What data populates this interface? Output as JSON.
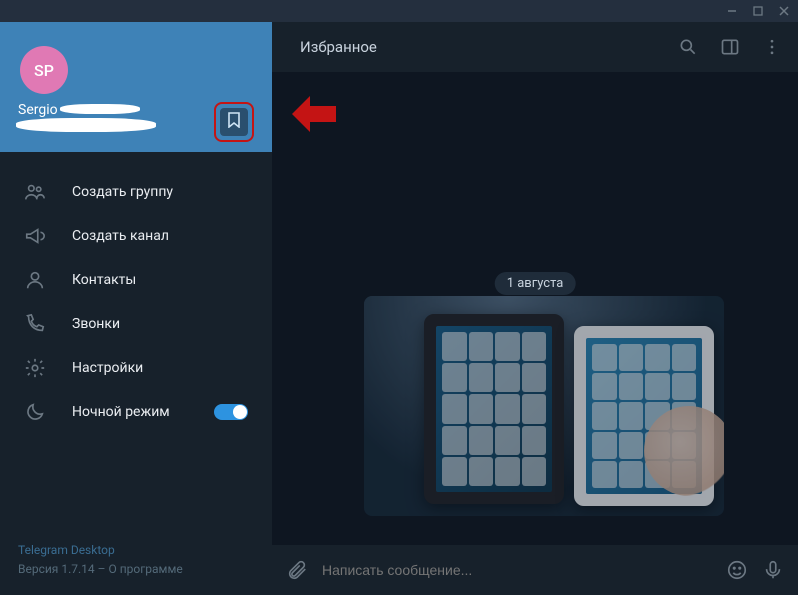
{
  "profile": {
    "initials": "SP",
    "name_visible_part": "Sergio"
  },
  "menu": {
    "new_group": "Создать группу",
    "new_channel": "Создать канал",
    "contacts": "Контакты",
    "calls": "Звонки",
    "settings": "Настройки",
    "night_mode": "Ночной режим"
  },
  "footer": {
    "app_name": "Telegram Desktop",
    "version_prefix": "Версия ",
    "version": "1.7.14",
    "separator": " – ",
    "about": "О программе"
  },
  "chat": {
    "title": "Избранное",
    "date_label": "1 августа"
  },
  "composer": {
    "placeholder": "Написать сообщение..."
  }
}
